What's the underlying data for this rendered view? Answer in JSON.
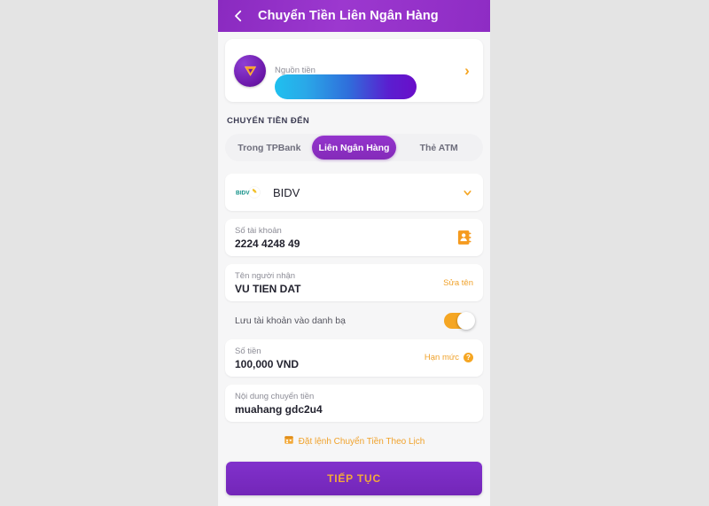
{
  "header": {
    "title": "Chuyển Tiền Liên Ngân Hàng",
    "back_icon": "arrow-left-icon",
    "background_color": "#8e2cc4"
  },
  "source": {
    "label": "Nguồn tiền",
    "value": "",
    "wallet_icon": "tpbank-wallet-icon",
    "chevron_icon": "chevron-right-icon",
    "redacted": true,
    "redaction_gradient_from": "#1fc0ef",
    "redaction_gradient_to": "#6a0ec9"
  },
  "section": {
    "title": "CHUYỂN TIỀN ĐẾN"
  },
  "tabs": [
    {
      "label": "Trong TPBank",
      "active": false
    },
    {
      "label": "Liên Ngân Hàng",
      "active": true
    },
    {
      "label": "Thẻ ATM",
      "active": false
    }
  ],
  "bank": {
    "name": "BIDV",
    "logo_text": "BIDV",
    "logo_icon": "bidv-logo-icon",
    "chevron_icon": "chevron-down-icon",
    "chevron_color": "#f5a623"
  },
  "account": {
    "label": "Số tài khoản",
    "value": "2224 4248 49",
    "contact_icon": "contact-book-icon",
    "icon_color": "#f5a623"
  },
  "recipient": {
    "label": "Tên người nhận",
    "value": "VU TIEN DAT",
    "action": "Sửa tên",
    "action_color": "#f0a22b"
  },
  "save_contact": {
    "label": "Lưu tài khoản vào danh bạ",
    "enabled": true,
    "toggle_color": "#f5a623"
  },
  "amount": {
    "label": "Số tiền",
    "value": "100,000 VND",
    "action": "Hạn mức",
    "help_badge": "?",
    "action_color": "#f0a22b"
  },
  "note": {
    "label": "Nội dung chuyển tiền",
    "value": "muahang gdc2u4"
  },
  "scheduled": {
    "label": "Đặt lệnh Chuyển Tiền Theo Lịch",
    "icon": "calendar-icon",
    "color": "#f0a22b"
  },
  "continue": {
    "label": "TIẾP TỤC",
    "background_color": "#7a2dc2",
    "text_color": "#f3a93a"
  }
}
